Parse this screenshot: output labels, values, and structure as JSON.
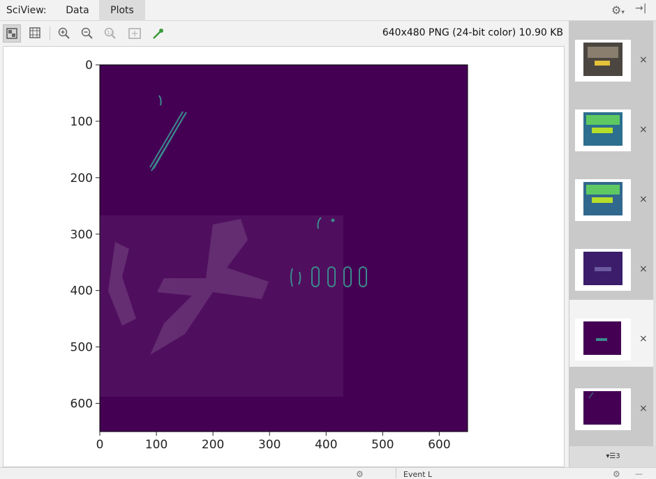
{
  "sciview": {
    "title": "SciView:",
    "tabs": [
      {
        "label": "Data"
      },
      {
        "label": "Plots"
      }
    ],
    "active_tab": "Plots",
    "settings_glyph": "⚙",
    "settings_caret": "▾",
    "hide_glyph": "→|"
  },
  "toolbar": {
    "image_info": "640x480 PNG (24-bit color) 10.90 KB",
    "tools": [
      {
        "icon": "checkerboard-background-icon",
        "active": true
      },
      {
        "icon": "grid-icon",
        "active": false
      },
      {
        "icon": "zoom-in-icon",
        "active": false
      },
      {
        "icon": "zoom-out-icon",
        "active": false
      },
      {
        "icon": "actual-size-icon",
        "active": false
      },
      {
        "icon": "fit-to-window-icon",
        "active": false
      },
      {
        "icon": "color-picker-icon",
        "active": false
      }
    ]
  },
  "plot": {
    "y_ticks": [
      "0",
      "100",
      "200",
      "300",
      "400",
      "500",
      "600"
    ],
    "x_ticks": [
      "0",
      "100",
      "200",
      "300",
      "400",
      "500",
      "600"
    ],
    "background_color": "#440154",
    "edge_color": "#3b8a8c"
  },
  "chart_data": {
    "type": "heatmap",
    "xlim": [
      0,
      650
    ],
    "ylim": [
      650,
      0
    ],
    "x_ticks": [
      0,
      100,
      200,
      300,
      400,
      500,
      600
    ],
    "y_ticks": [
      0,
      100,
      200,
      300,
      400,
      500,
      600
    ],
    "colormap": "viridis",
    "description_values": "edge-detection image, mostly zero with thin edge contours"
  },
  "thumbnails": {
    "items": [
      {
        "icon": "thumbnail-car-photo",
        "close": "×"
      },
      {
        "icon": "thumbnail-viridis-car",
        "close": "×"
      },
      {
        "icon": "thumbnail-viridis-car-2",
        "close": "×"
      },
      {
        "icon": "thumbnail-dark-car",
        "close": "×"
      },
      {
        "icon": "thumbnail-edges",
        "close": "×"
      },
      {
        "icon": "thumbnail-edges-2",
        "close": "×"
      }
    ],
    "footer": "▾☰3",
    "selected_index": 4
  },
  "bottom": {
    "gear": "⚙",
    "label": "Event L",
    "gear2": "⚙",
    "dash": "—"
  }
}
